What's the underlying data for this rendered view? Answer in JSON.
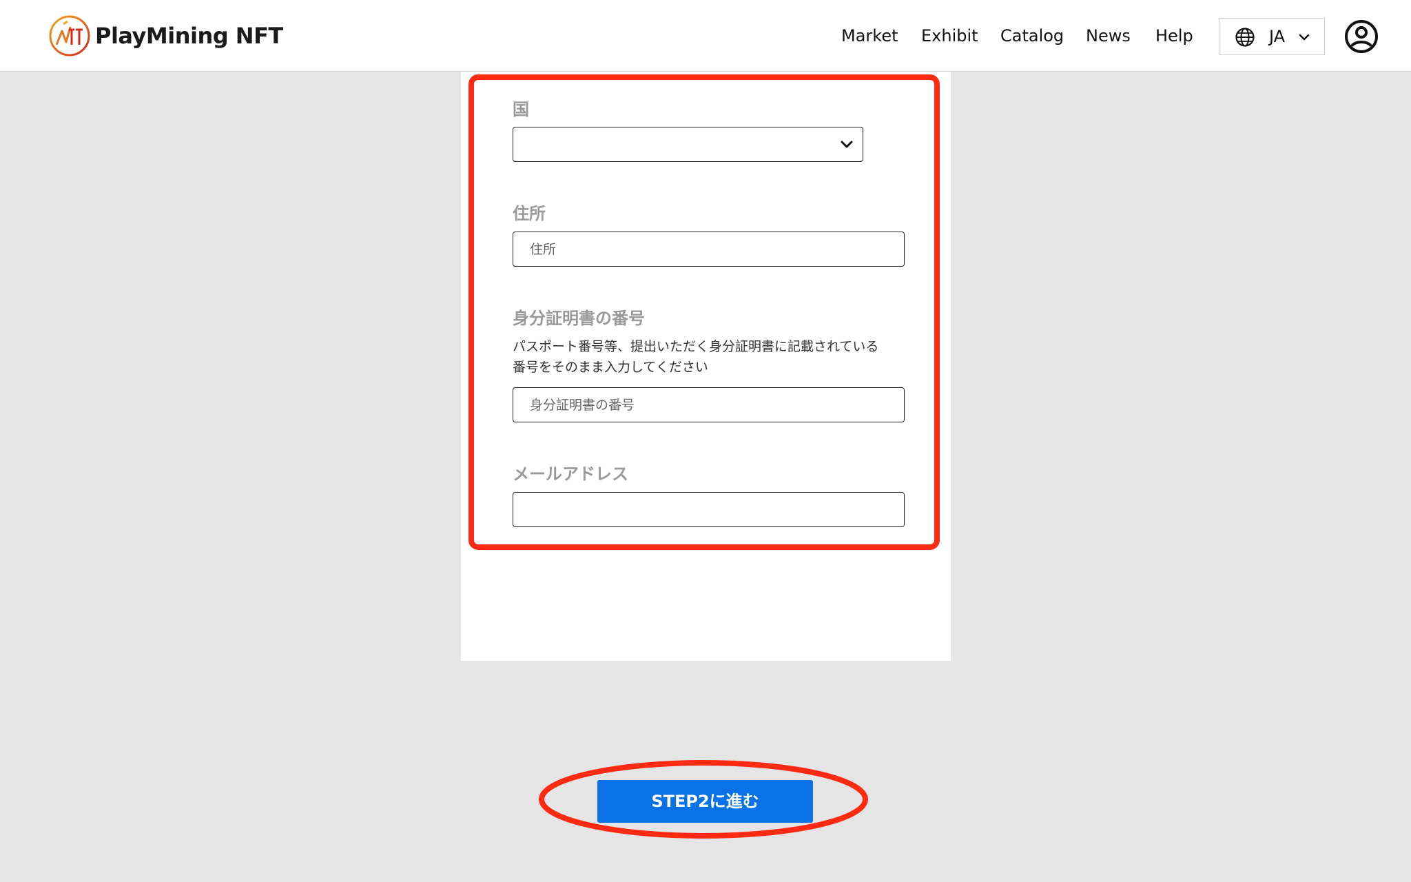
{
  "header": {
    "brand": "PlayMining NFT",
    "nav": [
      {
        "label": "Market"
      },
      {
        "label": "Exhibit"
      },
      {
        "label": "Catalog"
      },
      {
        "label": "News"
      },
      {
        "label": "Help"
      }
    ],
    "language": {
      "code": "JA",
      "icon": "globe-icon"
    },
    "user_icon": "user-circle-icon"
  },
  "form": {
    "country": {
      "label": "国",
      "value": ""
    },
    "address": {
      "label": "住所",
      "placeholder": "住所",
      "value": ""
    },
    "id_number": {
      "label": "身分証明書の番号",
      "help_line1": "パスポート番号等、提出いただく身分証明書に記載されている",
      "help_line2": "番号をそのまま入力してください",
      "placeholder": "身分証明書の番号",
      "value": ""
    },
    "email": {
      "label": "メールアドレス",
      "value": ""
    }
  },
  "actions": {
    "next_step_label": "STEP2に進む"
  },
  "colors": {
    "primary_button": "#0a72e6",
    "highlight": "#ff2a12",
    "page_background": "#e5e5e5",
    "label_gray": "#999999"
  }
}
